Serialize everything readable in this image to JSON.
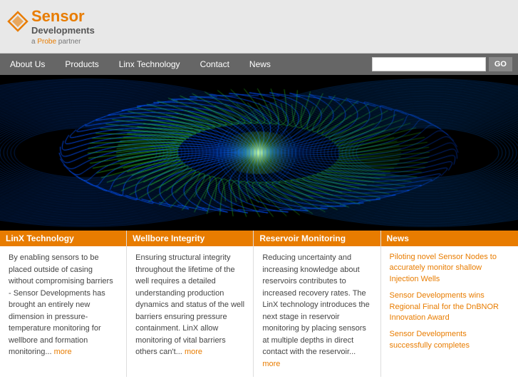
{
  "header": {
    "logo_sensor": "Sensor",
    "logo_developments": "Developments",
    "logo_probe": "a Probe partner"
  },
  "nav": {
    "items": [
      {
        "label": "About Us",
        "id": "about-us"
      },
      {
        "label": "Products",
        "id": "products"
      },
      {
        "label": "Linx Technology",
        "id": "linx-technology"
      },
      {
        "label": "Contact",
        "id": "contact"
      },
      {
        "label": "News",
        "id": "news"
      }
    ],
    "search_placeholder": "",
    "go_label": "GO"
  },
  "columns": [
    {
      "id": "linx",
      "header": "LinX Technology",
      "body": "By enabling sensors to be placed outside of casing without compromising barriers - Sensor Developments has brought an entirely new dimension in pressure-temperature monitoring for wellbore and formation monitoring...",
      "more": "more"
    },
    {
      "id": "wellbore",
      "header": "Wellbore Integrity",
      "body": "Ensuring structural integrity throughout the lifetime of the well requires a detailed understanding production dynamics and status of the well barriers ensuring pressure containment. LinX allow monitoring of vital barriers others can't...",
      "more": "more"
    },
    {
      "id": "reservoir",
      "header": "Reservoir Monitoring",
      "body": "Reducing uncertainty and increasing knowledge about reservoirs contributes to increased recovery rates. The LinX technology introduces the next stage in reservoir monitoring by placing sensors at multiple depths in direct contact with the reservoir...",
      "more": "more"
    }
  ],
  "news": {
    "header": "News",
    "items": [
      {
        "label": "Piloting novel Sensor Nodes to accurately monitor shallow Injection Wells"
      },
      {
        "label": "Sensor Developments wins Regional Final for the DnBNOR Innovation Award"
      },
      {
        "label": "Sensor Developments successfully completes"
      }
    ]
  }
}
